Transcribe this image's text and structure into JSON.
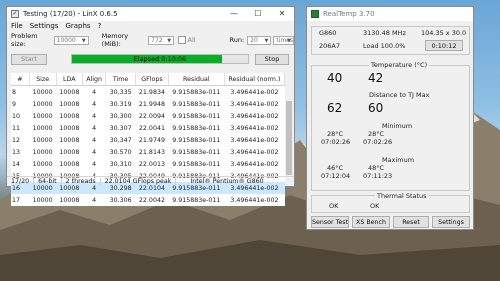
{
  "linx": {
    "title": "Testing (17/20) - LinX 0.6.5",
    "menu": [
      "File",
      "Settings",
      "Graphs",
      "?"
    ],
    "problem_size_label": "Problem size:",
    "problem_size_value": "10000",
    "memory_label": "Memory (MiB):",
    "memory_value": "772",
    "all_label": "All",
    "run_label": "Run:",
    "run_value": "20",
    "run_unit": "times",
    "start_label": "Start",
    "elapsed_label": "Elapsed 0:10:06",
    "progress_fraction": 0.85,
    "stop_label": "Stop",
    "columns": [
      "#",
      "Size",
      "LDA",
      "Align",
      "Time",
      "GFlops",
      "Residual",
      "Residual (norm.)"
    ],
    "rows": [
      [
        "8",
        "10000",
        "10008",
        "4",
        "30.335",
        "21.9834",
        "9.915883e-011",
        "3.496441e-002"
      ],
      [
        "9",
        "10000",
        "10008",
        "4",
        "30.319",
        "21.9948",
        "9.915883e-011",
        "3.496441e-002"
      ],
      [
        "10",
        "10000",
        "10008",
        "4",
        "30.300",
        "22.0094",
        "9.915883e-011",
        "3.496441e-002"
      ],
      [
        "11",
        "10000",
        "10008",
        "4",
        "30.307",
        "22.0041",
        "9.915883e-011",
        "3.496441e-002"
      ],
      [
        "12",
        "10000",
        "10008",
        "4",
        "30.347",
        "21.9749",
        "9.915883e-011",
        "3.496441e-002"
      ],
      [
        "13",
        "10000",
        "10008",
        "4",
        "30.570",
        "21.8143",
        "9.915883e-011",
        "3.496441e-002"
      ],
      [
        "14",
        "10000",
        "10008",
        "4",
        "30.310",
        "22.0013",
        "9.915883e-011",
        "3.496441e-002"
      ],
      [
        "15",
        "10000",
        "10008",
        "4",
        "30.305",
        "22.0049",
        "9.915883e-011",
        "3.496441e-002"
      ],
      [
        "16",
        "10000",
        "10008",
        "4",
        "30.298",
        "22.0104",
        "9.915883e-011",
        "3.496441e-002"
      ],
      [
        "17",
        "10000",
        "10008",
        "4",
        "30.306",
        "22.0042",
        "9.915883e-011",
        "3.496441e-002"
      ]
    ],
    "selected_row": 8,
    "status": [
      "17/20",
      "64-bit",
      "2 threads",
      "22.0104 GFlops peak",
      "Intel® Pentium® G860"
    ]
  },
  "realtemp": {
    "title": "RealTemp 3.70",
    "cpu_model": "G860",
    "frequency": "3130.48 MHz",
    "multiplier": "104.35 x 30.0",
    "cpuid": "206A7",
    "load": "Load 100.0%",
    "timer": "0:10:12",
    "temperature_label": "Temperature (°C)",
    "temp1": "40",
    "temp2": "42",
    "distance_label": "Distance to TJ Max",
    "dist1": "62",
    "dist2": "60",
    "minimum_label": "Minimum",
    "min1": "28°C",
    "min2": "28°C",
    "min_time1": "07:02:26",
    "min_time2": "07:02:26",
    "maximum_label": "Maximum",
    "max1": "46°C",
    "max2": "48°C",
    "max_time1": "07:12:04",
    "max_time2": "07:11:23",
    "thermal_status_label": "Thermal Status",
    "status1": "OK",
    "status2": "OK",
    "buttons": [
      "Sensor Test",
      "XS Bench",
      "Reset",
      "Settings"
    ]
  },
  "colors": {
    "progress": "#06b025",
    "selection": "#cce8ff",
    "realtemp_icon": "#2a7d3c"
  }
}
